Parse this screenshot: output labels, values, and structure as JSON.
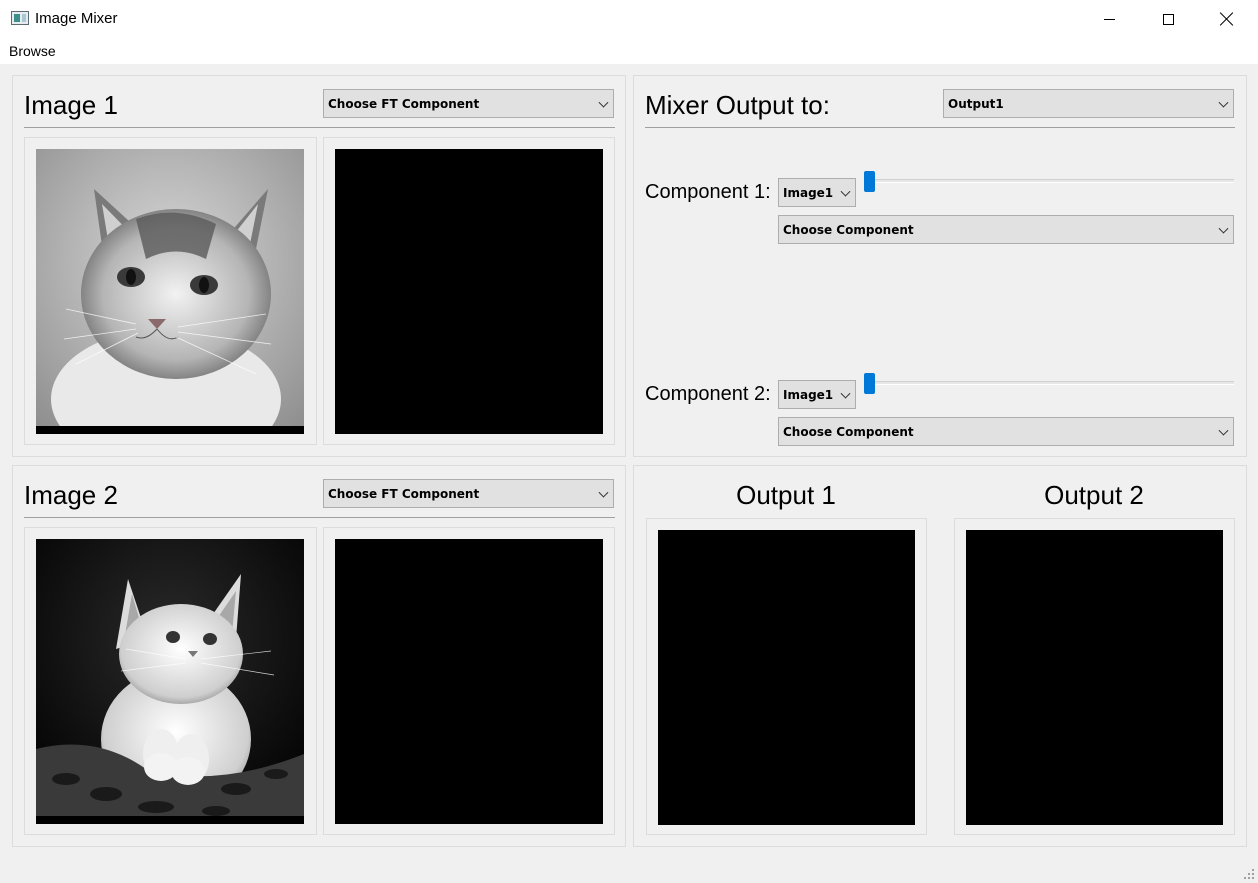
{
  "window": {
    "title": "Image Mixer",
    "icon": "app-window-icon"
  },
  "menu": {
    "items": [
      {
        "label": "Browse"
      }
    ]
  },
  "image1": {
    "title": "Image 1",
    "ft_combo": "Choose FT Component",
    "photo": "grayscale-kitten-photo"
  },
  "image2": {
    "title": "Image 2",
    "ft_combo": "Choose FT Component",
    "photo": "grayscale-kitten-photo"
  },
  "mixer": {
    "title": "Mixer Output to:",
    "output_select": "Output1",
    "component1": {
      "label": "Component 1:",
      "image_select": "Image1",
      "component_select": "Choose Component",
      "slider_value": 0
    },
    "component2": {
      "label": "Component 2:",
      "image_select": "Image1",
      "component_select": "Choose Component",
      "slider_value": 0
    }
  },
  "outputs": {
    "output1_title": "Output 1",
    "output2_title": "Output 2"
  },
  "colors": {
    "accent": "#0078d7",
    "background": "#f0f0f0",
    "viewer": "#000000"
  }
}
